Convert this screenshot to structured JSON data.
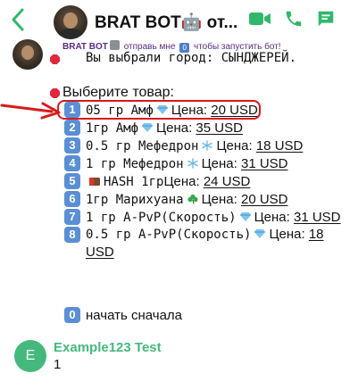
{
  "header": {
    "title": "BRAT BOT🤖 от...",
    "back_icon": "chevron-left-icon",
    "icons": [
      "video-icon",
      "phone-icon",
      "chat-icon"
    ],
    "accent_color": "#2fb86b"
  },
  "bot_note": {
    "name": "BRAT BOT",
    "text_before": " отправь мне ",
    "zero_glyph": "0",
    "text_after": " чтобы запустить бот!"
  },
  "message": {
    "city_text": "Вы выбрали город: СЫНДЖЕРЕЙ.",
    "choose_text": "Выберите товар:",
    "items": [
      {
        "num": "1",
        "name": "05 гр Амф",
        "emoji": "diamond",
        "price_label": "Цена:",
        "price": "20 USD"
      },
      {
        "num": "2",
        "name": "1гр Амф",
        "emoji": "diamond",
        "price_label": "Цена:",
        "price": "35 USD"
      },
      {
        "num": "3",
        "name": "0.5 гр Мефедрон",
        "emoji": "snowflake",
        "price_label": "Цена:",
        "price": "18 USD"
      },
      {
        "num": "4",
        "name": "1 гр Мефедрон",
        "emoji": "snowflake",
        "price_label": "Цена:",
        "price": "31 USD"
      },
      {
        "num": "5",
        "name": "HASH 1гр",
        "emoji": "chocolate",
        "price_label": "Цена:",
        "price": "24 USD"
      },
      {
        "num": "6",
        "name": "1гр Марихуана",
        "emoji": "shamrock",
        "price_label": "Цена:",
        "price": "20 USD"
      },
      {
        "num": "7",
        "name": "1 гр A-PvP(Скорость)",
        "emoji": "gem",
        "price_label": "Цена:",
        "price": "31 USD"
      },
      {
        "num": "8",
        "name": "0.5 гр A-PvP(Скорость)",
        "emoji": "gem",
        "price_label": "Цена:",
        "price": "18 USD"
      }
    ],
    "restart_num": "0",
    "restart_text": "начать сначала"
  },
  "reply": {
    "avatar_letter": "E",
    "name": "Example123 Test",
    "text": "1",
    "color": "#45b97c"
  },
  "annotation": {
    "highlight_color": "#d71a1a"
  }
}
